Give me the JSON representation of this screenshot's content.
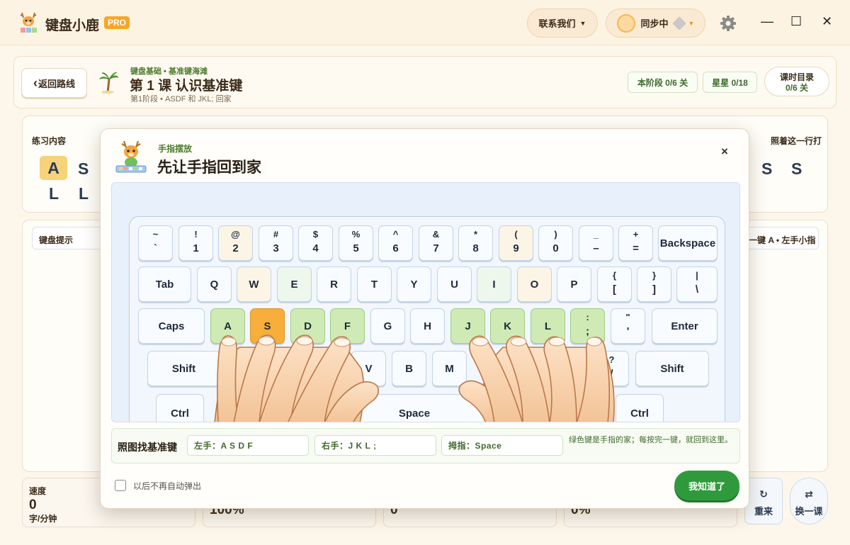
{
  "app": {
    "name": "键盘小鹿",
    "badge": "PRO"
  },
  "topbar": {
    "contact_label": "联系我们",
    "sync_label": "同步中",
    "dropdown_icon": "caret-down-icon",
    "settings_icon": "gear-icon",
    "minimize": "—",
    "maximize": "☐",
    "close": "✕"
  },
  "header": {
    "back_label": "返回路线",
    "back_arrow": "‹",
    "crumb": "键盘基础 • 基准键海滩",
    "title": "第 1 课 认识基准键",
    "subtitle": "第1阶段 • ASDF 和 JKL; 回家",
    "stage_progress": "本阶段 0/6 关",
    "stars": "星星 0/18",
    "catalog_title": "课时目录",
    "catalog_count": "0/6 关"
  },
  "background": {
    "practice_label": "练习内容",
    "follow_label": "照着这一行打",
    "keyboard_hint_label": "键盘提示",
    "next_key_hint": "一键 A • 左手小指",
    "practice_row1": [
      "A",
      "S"
    ],
    "practice_row2": [
      "L",
      "L"
    ],
    "practice_right": [
      "S",
      "S"
    ],
    "stats": [
      {
        "label": "速度",
        "value": "0",
        "unit": "字/分钟"
      },
      {
        "label": "",
        "value": "100%",
        "unit": ""
      },
      {
        "label": "",
        "value": "0",
        "unit": ""
      },
      {
        "label": "",
        "value": "0%",
        "unit": ""
      }
    ],
    "restart_icon": "↻",
    "restart_label": "重来",
    "switch_icon": "⇄",
    "switch_label": "换一课"
  },
  "modal": {
    "eyebrow": "手指摆放",
    "title": "先让手指回到家",
    "close_label": "×",
    "keyboard": {
      "number_row": [
        {
          "top": "~",
          "bottom": "`"
        },
        {
          "top": "!",
          "bottom": "1"
        },
        {
          "top": "@",
          "bottom": "2"
        },
        {
          "top": "#",
          "bottom": "3"
        },
        {
          "top": "$",
          "bottom": "4"
        },
        {
          "top": "%",
          "bottom": "5"
        },
        {
          "top": "^",
          "bottom": "6"
        },
        {
          "top": "&",
          "bottom": "7"
        },
        {
          "top": "*",
          "bottom": "8"
        },
        {
          "top": "(",
          "bottom": "9"
        },
        {
          "top": ")",
          "bottom": "0"
        },
        {
          "top": "_",
          "bottom": "–"
        },
        {
          "top": "+",
          "bottom": "="
        },
        {
          "label": "Backspace"
        }
      ],
      "top_row": [
        {
          "label": "Tab"
        },
        {
          "label": "Q"
        },
        {
          "label": "W"
        },
        {
          "label": "E"
        },
        {
          "label": "R"
        },
        {
          "label": "T"
        },
        {
          "label": "Y"
        },
        {
          "label": "U"
        },
        {
          "label": "I"
        },
        {
          "label": "O"
        },
        {
          "label": "P"
        },
        {
          "top": "{",
          "bottom": "["
        },
        {
          "top": "}",
          "bottom": "]"
        },
        {
          "top": "|",
          "bottom": "\\"
        }
      ],
      "home_row": [
        {
          "label": "Caps"
        },
        {
          "label": "A"
        },
        {
          "label": "S"
        },
        {
          "label": "D"
        },
        {
          "label": "F"
        },
        {
          "label": "G"
        },
        {
          "label": "H"
        },
        {
          "label": "J"
        },
        {
          "label": "K"
        },
        {
          "label": "L"
        },
        {
          "top": ":",
          "bottom": ";"
        },
        {
          "top": "\"",
          "bottom": "'"
        },
        {
          "label": "Enter"
        }
      ],
      "bottom_row": [
        {
          "label": "Shift"
        },
        {
          "label": "V"
        },
        {
          "label": "B"
        },
        {
          "label": "M"
        },
        {
          "top": "?",
          "bottom": "/"
        },
        {
          "label": "Shift"
        }
      ],
      "space_row": [
        {
          "label": "Ctrl"
        },
        {
          "label": "Space"
        },
        {
          "label": "Ctrl"
        }
      ]
    },
    "guide": {
      "title": "照图找基准键",
      "left_hand": "左手：A S D F",
      "right_hand": "右手：J K L ;",
      "thumb": "拇指：Space",
      "note": "绿色键是手指的家；每按完一键，就回到这里。"
    },
    "dont_show_again": "以后不再自动弹出",
    "confirm_label": "我知道了"
  },
  "colors": {
    "accent_green": "#2f9a3c",
    "home_key": "#cfeab5",
    "active_key": "#f7ae3a",
    "pro_badge": "#f7a628"
  }
}
